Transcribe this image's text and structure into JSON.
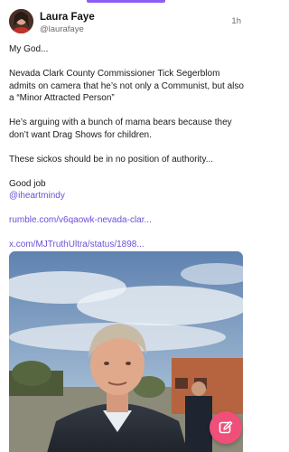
{
  "post": {
    "author_name": "Laura Faye",
    "author_handle": "@laurafaye",
    "timestamp": "1h",
    "paragraphs": [
      "My God...",
      "Nevada Clark County Commissioner Tick Segerblom admits on camera that he’s not only a Communist, but also a “Minor Attracted Person”",
      "He’s arguing with a bunch of mama bears because they don’t want Drag Shows for children.",
      "These sickos should be in no position of authority...",
      "Good job"
    ],
    "mention": "@iheartmindy",
    "links": [
      "rumble.com/v6qaowk-nevada-clar...",
      "x.com/MJTruthUltra/status/1898..."
    ]
  },
  "media": {
    "kind": "video-thumbnail"
  },
  "fab": {
    "icon": "compose-icon"
  },
  "colors": {
    "accent": "#8b5cf6",
    "link": "#6d4fd6",
    "fab": "#ef4f78"
  }
}
